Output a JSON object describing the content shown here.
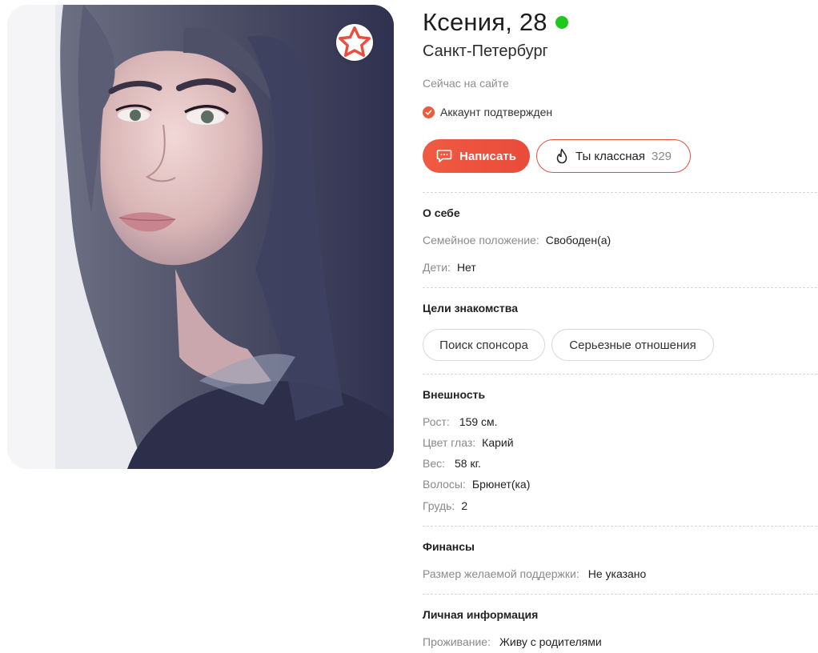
{
  "profile": {
    "name_age": "Ксения, 28",
    "city": "Санкт-Петербург",
    "online_status": "Сейчас на сайте",
    "verified_text": "Аккаунт подтвержден",
    "online_color": "#1ec81e"
  },
  "actions": {
    "write_label": "Написать",
    "like_label": "Ты классная",
    "like_count": "329",
    "accent_color": "#ec4d3c"
  },
  "about": {
    "title": "О себе",
    "rows": [
      {
        "label": "Семейное положение:",
        "value": "Свободен(а)"
      },
      {
        "label": "Дети:",
        "value": "Нет"
      }
    ]
  },
  "goals": {
    "title": "Цели знакомства",
    "tags": [
      "Поиск спонсора",
      "Серьезные отношения"
    ]
  },
  "appearance": {
    "title": "Внешность",
    "rows": [
      {
        "label": "Рост:",
        "value": "159 см."
      },
      {
        "label": "Цвет глаз:",
        "value": "Карий"
      },
      {
        "label": "Вес:",
        "value": "58 кг."
      },
      {
        "label": "Волосы:",
        "value": "Брюнет(ка)"
      },
      {
        "label": "Грудь:",
        "value": "2"
      }
    ]
  },
  "finance": {
    "title": "Финансы",
    "rows": [
      {
        "label": "Размер желаемой поддержки:",
        "value": "Не указано"
      }
    ]
  },
  "personal": {
    "title": "Личная информация",
    "rows": [
      {
        "label": "Проживание:",
        "value": "Живу с родителями"
      }
    ]
  },
  "icons": {
    "favorite": "star-outline-icon",
    "write": "chat-bubble-icon",
    "like": "flame-icon",
    "verified": "check-circle-icon"
  }
}
